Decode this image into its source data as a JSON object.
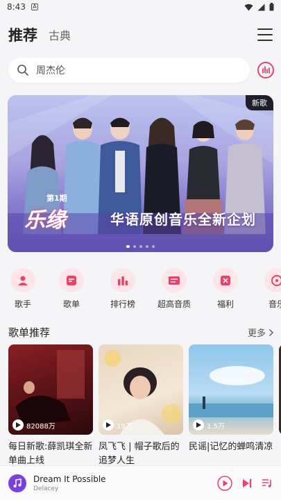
{
  "status_bar": {
    "time": "8:43",
    "notification_letter": "A"
  },
  "header": {
    "tab_active": "推荐",
    "tab_other": "古典"
  },
  "search": {
    "placeholder": "周杰伦"
  },
  "banner": {
    "badge": "新歌",
    "episode": "第1期",
    "logo": "乐缘",
    "caption": "华语原创音乐全新企划",
    "slide_count": 5,
    "active_slide": 0
  },
  "categories": [
    {
      "label": "歌手",
      "icon": "singer-icon"
    },
    {
      "label": "歌单",
      "icon": "playlist-icon"
    },
    {
      "label": "排行榜",
      "icon": "chart-icon"
    },
    {
      "label": "超高音质",
      "icon": "hires-icon"
    },
    {
      "label": "福利",
      "icon": "gift-icon"
    },
    {
      "label": "音乐",
      "icon": "music-icon"
    }
  ],
  "section": {
    "title": "歌单推荐",
    "more": "更多"
  },
  "playlists": [
    {
      "title": "每日新歌:薛凯琪全新单曲上线",
      "count": "82088万"
    },
    {
      "title": "凤飞飞 | 帽子歌后的追梦人生",
      "count": "19万"
    },
    {
      "title": "民谣|记忆的蝉鸣清凉",
      "count": "1.5万"
    }
  ],
  "player": {
    "song": "Dream It Possible",
    "artist": "Delacey"
  },
  "colors": {
    "accent": "#e8426a",
    "icon_bg": "#fde5ea"
  }
}
